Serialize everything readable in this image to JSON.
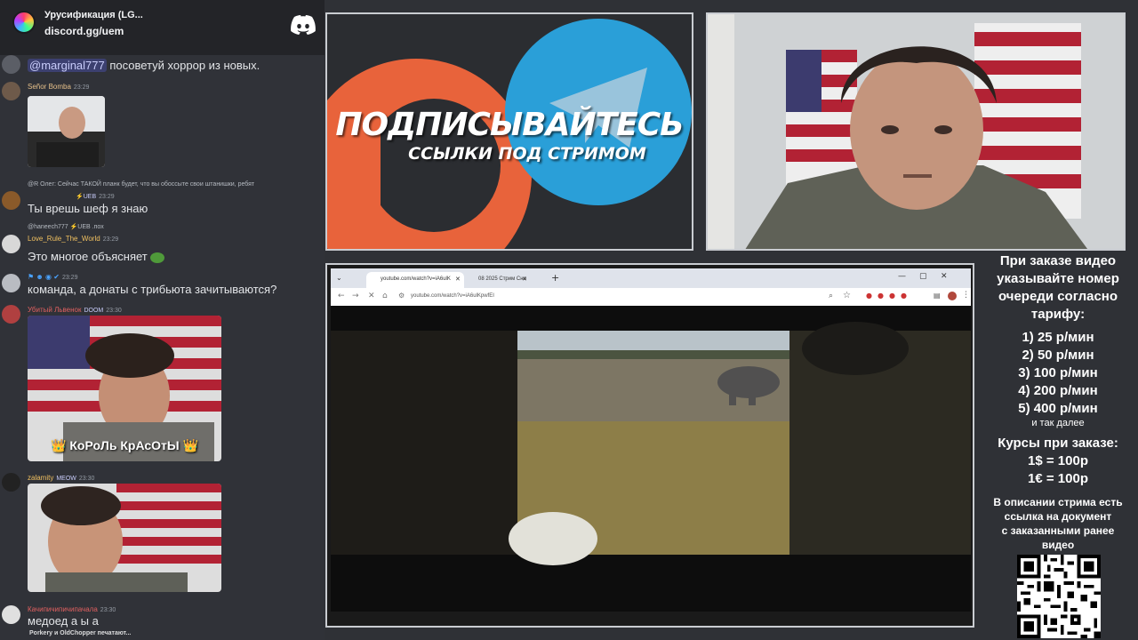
{
  "header": {
    "server_name": "Урусификация (LG...",
    "invite": "discord.gg/uem"
  },
  "messages": [
    {
      "text_mention": "@marginal777",
      "text": " посоветуй хоррор из новых."
    },
    {
      "user": "Señor Bomba",
      "time": "23:29"
    },
    {
      "reply": "@R Олег: Сейчас ТАКОЙ планк будет, что вы обоссыте свои штанишки, ребят",
      "tag": "⚡UEB",
      "time": "23:29",
      "text": "Ты врешь шеф я знаю"
    },
    {
      "reply": "@haneech777 ⚡UEB .пох",
      "user": "Love_Rule_The_World",
      "time": "23:29",
      "text": "Это многое объясняет"
    },
    {
      "time": "23:29",
      "text": "команда, а донаты с трибьюта зачитываются?"
    },
    {
      "user": "Убитый Львенок",
      "tag": "DOOM",
      "time": "23:30",
      "caption": "👑 КоРоЛь КрАсОтЫ 👑"
    },
    {
      "user": "zalamity",
      "tag": "MEOW",
      "time": "23:30"
    },
    {
      "user": "Качипичипичипачала",
      "time": "23:30",
      "text": "медоед а ы а"
    },
    {
      "typing": "Porkery и OldChopper печатают..."
    }
  ],
  "promo": {
    "title": "ПОДПИСЫВАЙТЕСЬ",
    "subtitle": "ССЫЛКИ ПОД СТРИМОМ"
  },
  "browser": {
    "tab1": "youtube.com/watch?v=iA6ulK",
    "tab2": "08 2025 Стрим Сно",
    "url": "youtube.com/watch?v=iA6ulKpwfEI"
  },
  "info": {
    "line1": "При заказе видео",
    "line2": "указывайте номер",
    "line3": "очереди согласно",
    "line4": "тарифу:",
    "t1": "1) 25 р/мин",
    "t2": "2) 50 р/мин",
    "t3": "3) 100 р/мин",
    "t4": "4) 200 р/мин",
    "t5": "5) 400 р/мин",
    "etc": "и так далее",
    "rates_title": "Курсы при заказе:",
    "rate1": "1$ = 100р",
    "rate2": "1€ = 100р",
    "desc1": "В описании стрима есть",
    "desc2": "ссылка на документ",
    "desc3": "с заказанными ранее",
    "desc4": "видео"
  },
  "colors": {
    "chat_bg": "#303238",
    "header_bg": "#232428",
    "discord_blurple": "#5865F2",
    "telegram_blue": "#2A9FD8",
    "patreon_orange": "#E8633B"
  }
}
